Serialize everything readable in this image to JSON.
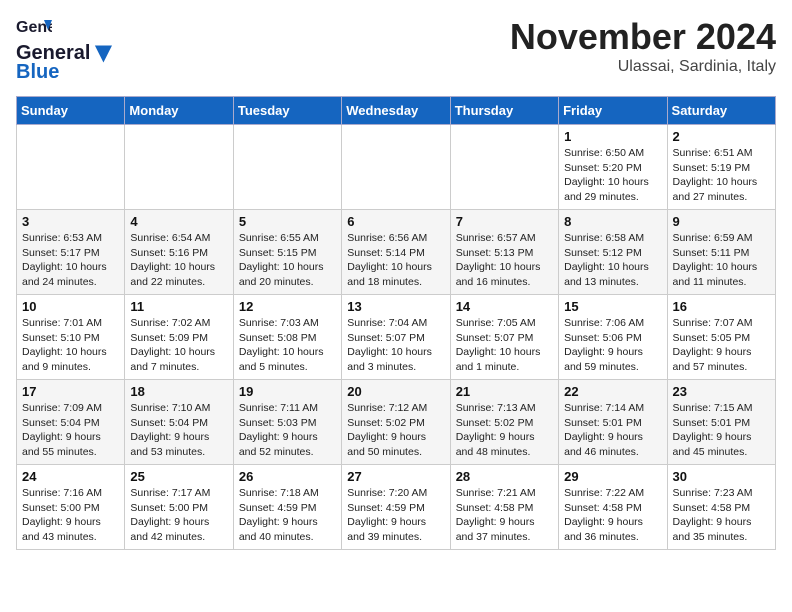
{
  "header": {
    "logo_line1": "General",
    "logo_line2": "Blue",
    "month": "November 2024",
    "location": "Ulassai, Sardinia, Italy"
  },
  "weekdays": [
    "Sunday",
    "Monday",
    "Tuesday",
    "Wednesday",
    "Thursday",
    "Friday",
    "Saturday"
  ],
  "weeks": [
    [
      {
        "day": "",
        "info": ""
      },
      {
        "day": "",
        "info": ""
      },
      {
        "day": "",
        "info": ""
      },
      {
        "day": "",
        "info": ""
      },
      {
        "day": "",
        "info": ""
      },
      {
        "day": "1",
        "info": "Sunrise: 6:50 AM\nSunset: 5:20 PM\nDaylight: 10 hours and 29 minutes."
      },
      {
        "day": "2",
        "info": "Sunrise: 6:51 AM\nSunset: 5:19 PM\nDaylight: 10 hours and 27 minutes."
      }
    ],
    [
      {
        "day": "3",
        "info": "Sunrise: 6:53 AM\nSunset: 5:17 PM\nDaylight: 10 hours and 24 minutes."
      },
      {
        "day": "4",
        "info": "Sunrise: 6:54 AM\nSunset: 5:16 PM\nDaylight: 10 hours and 22 minutes."
      },
      {
        "day": "5",
        "info": "Sunrise: 6:55 AM\nSunset: 5:15 PM\nDaylight: 10 hours and 20 minutes."
      },
      {
        "day": "6",
        "info": "Sunrise: 6:56 AM\nSunset: 5:14 PM\nDaylight: 10 hours and 18 minutes."
      },
      {
        "day": "7",
        "info": "Sunrise: 6:57 AM\nSunset: 5:13 PM\nDaylight: 10 hours and 16 minutes."
      },
      {
        "day": "8",
        "info": "Sunrise: 6:58 AM\nSunset: 5:12 PM\nDaylight: 10 hours and 13 minutes."
      },
      {
        "day": "9",
        "info": "Sunrise: 6:59 AM\nSunset: 5:11 PM\nDaylight: 10 hours and 11 minutes."
      }
    ],
    [
      {
        "day": "10",
        "info": "Sunrise: 7:01 AM\nSunset: 5:10 PM\nDaylight: 10 hours and 9 minutes."
      },
      {
        "day": "11",
        "info": "Sunrise: 7:02 AM\nSunset: 5:09 PM\nDaylight: 10 hours and 7 minutes."
      },
      {
        "day": "12",
        "info": "Sunrise: 7:03 AM\nSunset: 5:08 PM\nDaylight: 10 hours and 5 minutes."
      },
      {
        "day": "13",
        "info": "Sunrise: 7:04 AM\nSunset: 5:07 PM\nDaylight: 10 hours and 3 minutes."
      },
      {
        "day": "14",
        "info": "Sunrise: 7:05 AM\nSunset: 5:07 PM\nDaylight: 10 hours and 1 minute."
      },
      {
        "day": "15",
        "info": "Sunrise: 7:06 AM\nSunset: 5:06 PM\nDaylight: 9 hours and 59 minutes."
      },
      {
        "day": "16",
        "info": "Sunrise: 7:07 AM\nSunset: 5:05 PM\nDaylight: 9 hours and 57 minutes."
      }
    ],
    [
      {
        "day": "17",
        "info": "Sunrise: 7:09 AM\nSunset: 5:04 PM\nDaylight: 9 hours and 55 minutes."
      },
      {
        "day": "18",
        "info": "Sunrise: 7:10 AM\nSunset: 5:04 PM\nDaylight: 9 hours and 53 minutes."
      },
      {
        "day": "19",
        "info": "Sunrise: 7:11 AM\nSunset: 5:03 PM\nDaylight: 9 hours and 52 minutes."
      },
      {
        "day": "20",
        "info": "Sunrise: 7:12 AM\nSunset: 5:02 PM\nDaylight: 9 hours and 50 minutes."
      },
      {
        "day": "21",
        "info": "Sunrise: 7:13 AM\nSunset: 5:02 PM\nDaylight: 9 hours and 48 minutes."
      },
      {
        "day": "22",
        "info": "Sunrise: 7:14 AM\nSunset: 5:01 PM\nDaylight: 9 hours and 46 minutes."
      },
      {
        "day": "23",
        "info": "Sunrise: 7:15 AM\nSunset: 5:01 PM\nDaylight: 9 hours and 45 minutes."
      }
    ],
    [
      {
        "day": "24",
        "info": "Sunrise: 7:16 AM\nSunset: 5:00 PM\nDaylight: 9 hours and 43 minutes."
      },
      {
        "day": "25",
        "info": "Sunrise: 7:17 AM\nSunset: 5:00 PM\nDaylight: 9 hours and 42 minutes."
      },
      {
        "day": "26",
        "info": "Sunrise: 7:18 AM\nSunset: 4:59 PM\nDaylight: 9 hours and 40 minutes."
      },
      {
        "day": "27",
        "info": "Sunrise: 7:20 AM\nSunset: 4:59 PM\nDaylight: 9 hours and 39 minutes."
      },
      {
        "day": "28",
        "info": "Sunrise: 7:21 AM\nSunset: 4:58 PM\nDaylight: 9 hours and 37 minutes."
      },
      {
        "day": "29",
        "info": "Sunrise: 7:22 AM\nSunset: 4:58 PM\nDaylight: 9 hours and 36 minutes."
      },
      {
        "day": "30",
        "info": "Sunrise: 7:23 AM\nSunset: 4:58 PM\nDaylight: 9 hours and 35 minutes."
      }
    ]
  ]
}
